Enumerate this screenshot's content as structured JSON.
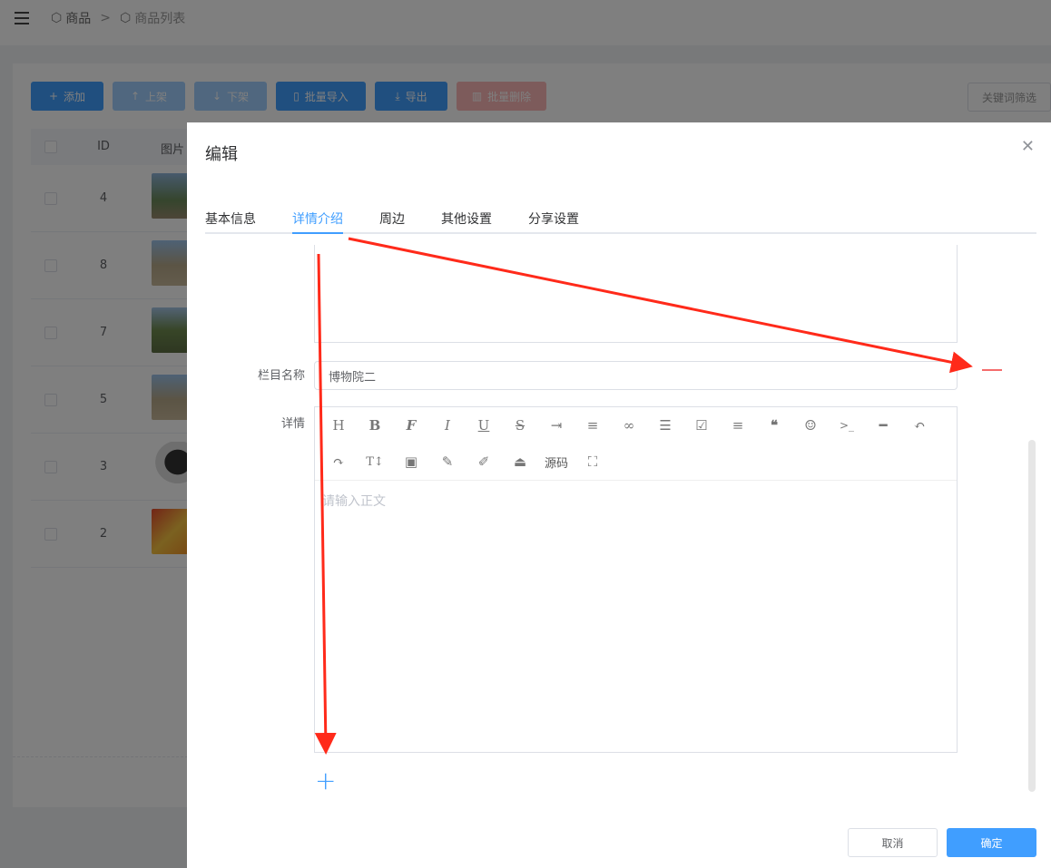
{
  "breadcrumb": {
    "items": [
      "商品",
      "商品列表"
    ],
    "separator": ">"
  },
  "toolbar": {
    "add": "添加",
    "up": "上架",
    "down": "下架",
    "import": "批量导入",
    "export": "导出",
    "delete": "批量删除"
  },
  "filter_label": "关键词筛选",
  "table": {
    "headers": [
      "ID",
      "图片"
    ],
    "rows": [
      {
        "id": "4"
      },
      {
        "id": "8"
      },
      {
        "id": "7"
      },
      {
        "id": "5"
      },
      {
        "id": "3"
      },
      {
        "id": "2"
      }
    ]
  },
  "dialog": {
    "title": "编辑",
    "close_icon": "close-icon",
    "tabs": [
      "基本信息",
      "详情介绍",
      "周边",
      "其他设置",
      "分享设置"
    ],
    "active_tab": "详情介绍",
    "column_name_label": "栏目名称",
    "column_name_value": "博物院二",
    "detail_label": "详情",
    "editor": {
      "toolbar_icons": [
        "heading-icon",
        "bold-icon",
        "font-icon",
        "italic-icon",
        "underline-icon",
        "strikethrough-icon",
        "indent-icon",
        "line-height-icon",
        "link-icon",
        "list-icon",
        "todo-checkbox-icon",
        "justify-icon",
        "quote-icon",
        "emoji-icon",
        "code-icon",
        "divider-icon",
        "undo-icon",
        "redo-icon",
        "font-size-icon",
        "image-icon",
        "clear-format-icon",
        "paint-brush-icon",
        "upload-icon",
        "source-code-button",
        "fullscreen-icon"
      ],
      "source_label": "源码",
      "placeholder": "请输入正文"
    },
    "cancel": "取消",
    "confirm": "确定"
  },
  "colors": {
    "primary": "#409eff",
    "danger": "#f56c6c",
    "annotation": "#ff2a1a"
  }
}
